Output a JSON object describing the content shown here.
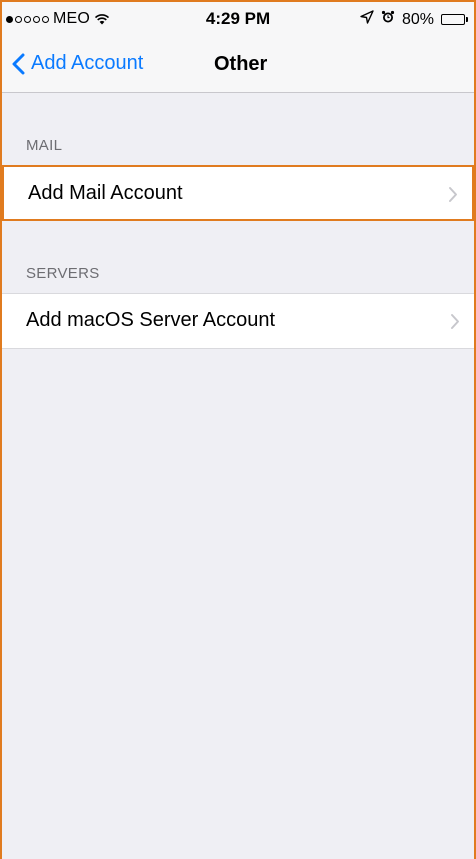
{
  "status_bar": {
    "carrier": "MEO",
    "time": "4:29 PM",
    "battery": "80%",
    "battery_level": 0.8,
    "signal_bars_filled": 1,
    "signal_bars_total": 5
  },
  "nav": {
    "back_label": "Add Account",
    "title": "Other"
  },
  "sections": [
    {
      "header": "MAIL",
      "items": [
        {
          "label": "Add Mail Account",
          "icon": "chevron-right-icon"
        }
      ]
    },
    {
      "header": "SERVERS",
      "items": [
        {
          "label": "Add macOS Server Account",
          "icon": "chevron-right-icon"
        }
      ]
    }
  ],
  "colors": {
    "accent": "#0a7aff",
    "highlight": "#e07b1f",
    "background": "#efeff4",
    "header_text": "#6d6d72"
  }
}
